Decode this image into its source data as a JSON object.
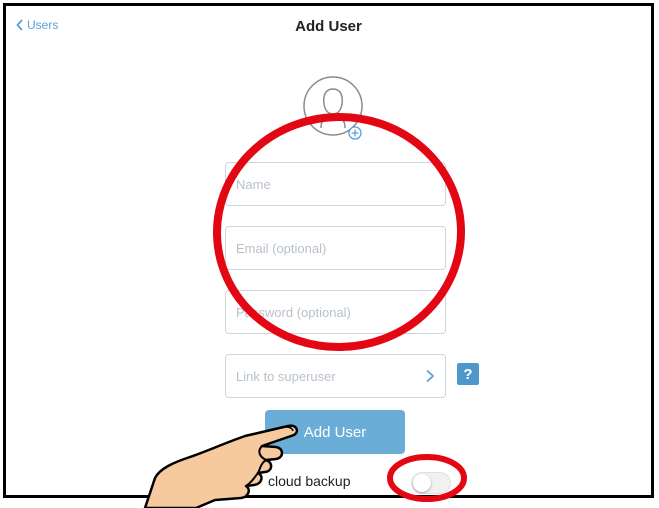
{
  "nav": {
    "back_label": "Users",
    "back_icon": "chevron-left-icon",
    "title": "Add User"
  },
  "avatar": {
    "icon": "user-avatar-icon",
    "add_icon": "plus-circle-icon"
  },
  "form": {
    "name_placeholder": "Name",
    "email_placeholder": "Email (optional)",
    "password_placeholder": "Password (optional)",
    "superuser_label": "Link to superuser",
    "superuser_chevron": "chevron-right-icon",
    "help_label": "?",
    "submit_label": "Add User",
    "backup_label": "cloud backup",
    "backup_enabled": false
  },
  "annotations": {
    "highlight_color": "#e30613",
    "pointer": "pointing-hand-icon"
  },
  "colors": {
    "accent": "#5aa0d6",
    "button": "#6aaed8",
    "help": "#4e97c9"
  }
}
